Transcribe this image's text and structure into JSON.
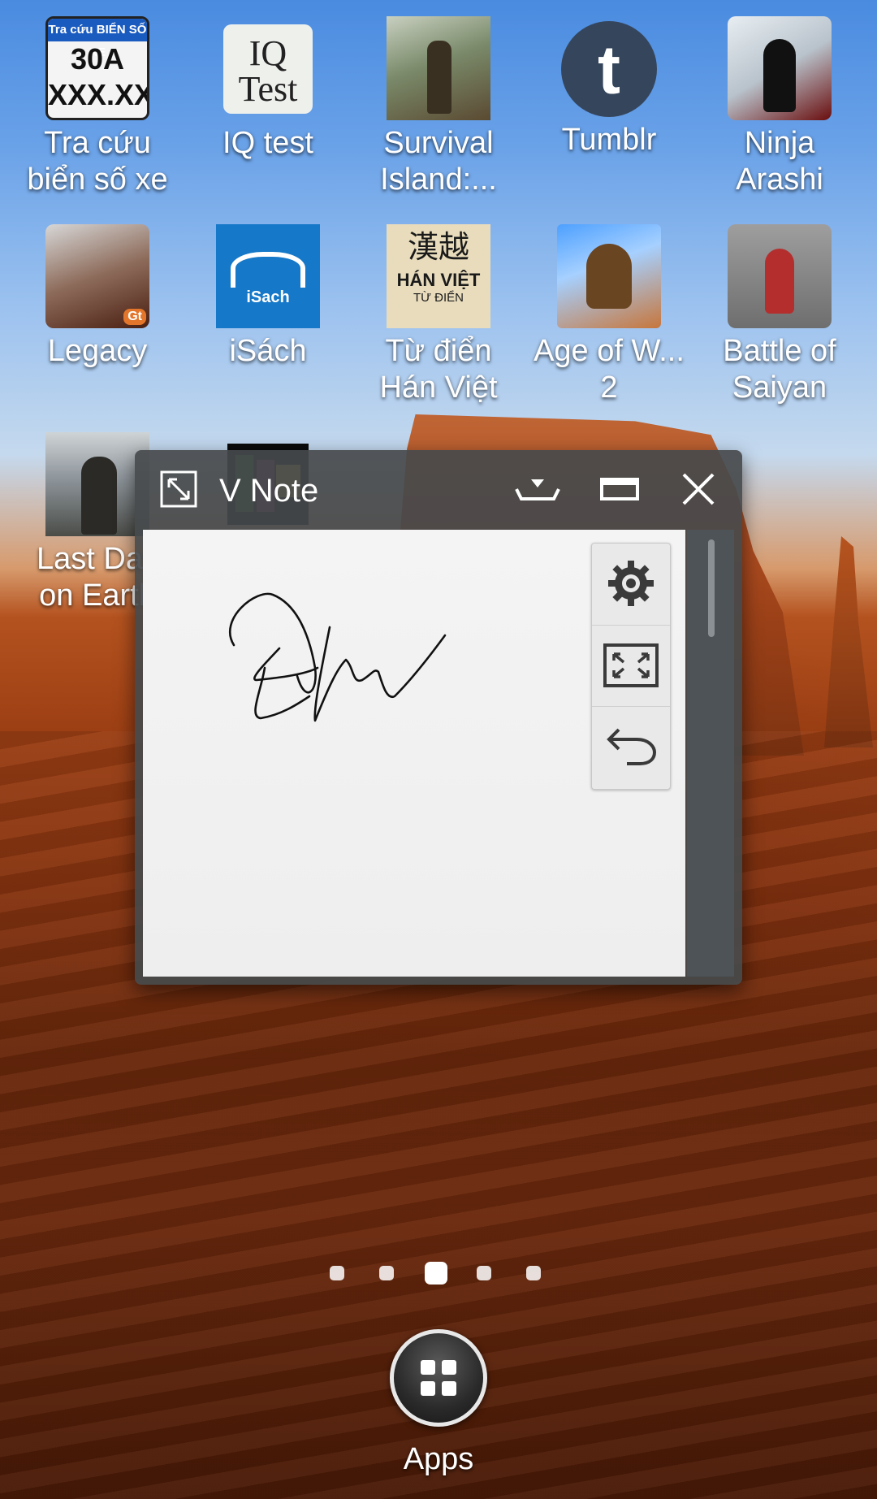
{
  "home_screen": {
    "apps": [
      {
        "label": "Tra cứu\nbiển số xe",
        "icon": "license-plate-lookup-icon"
      },
      {
        "label": "IQ test",
        "icon": "iq-test-icon"
      },
      {
        "label": "Survival\nIsland:...",
        "icon": "survival-island-icon"
      },
      {
        "label": "Tumblr",
        "icon": "tumblr-icon"
      },
      {
        "label": "Ninja\nArashi",
        "icon": "ninja-arashi-icon"
      },
      {
        "label": "Legacy",
        "icon": "legacy-icon"
      },
      {
        "label": "iSách",
        "icon": "isach-icon"
      },
      {
        "label": "Từ điển\nHán Việt",
        "icon": "han-viet-dictionary-icon"
      },
      {
        "label": "Age of W...\n2",
        "icon": "age-of-war-icon"
      },
      {
        "label": "Battle of\nSaiyan",
        "icon": "battle-of-saiyan-icon"
      },
      {
        "label": "Last Day\non Earth",
        "icon": "last-day-on-earth-icon"
      },
      {
        "label": "",
        "icon": "folder-icon"
      }
    ],
    "icon_text": {
      "bienso_top": "Tra cứu BIỂN SỐ XE",
      "bienso_line1": "30A",
      "bienso_line2": "XXX.XX",
      "iq_line1": "IQ",
      "iq_line2": "Test",
      "tumblr_glyph": "t",
      "isach_text": "iSach",
      "hanviet_cn": "漢越",
      "hanviet_line": "HÁN VIỆT",
      "hanviet_sub": "TỪ ĐIỂN"
    },
    "page_indicator": {
      "pages": 5,
      "current": 3
    },
    "apps_button_label": "Apps"
  },
  "vnote_window": {
    "title": "V Note",
    "toolbar": [
      "gear-icon",
      "fit-screen-icon",
      "undo-icon"
    ],
    "colors": {
      "titlebar": "#464a4c",
      "canvas": "#f2f2f2",
      "ink": "#111111"
    }
  }
}
